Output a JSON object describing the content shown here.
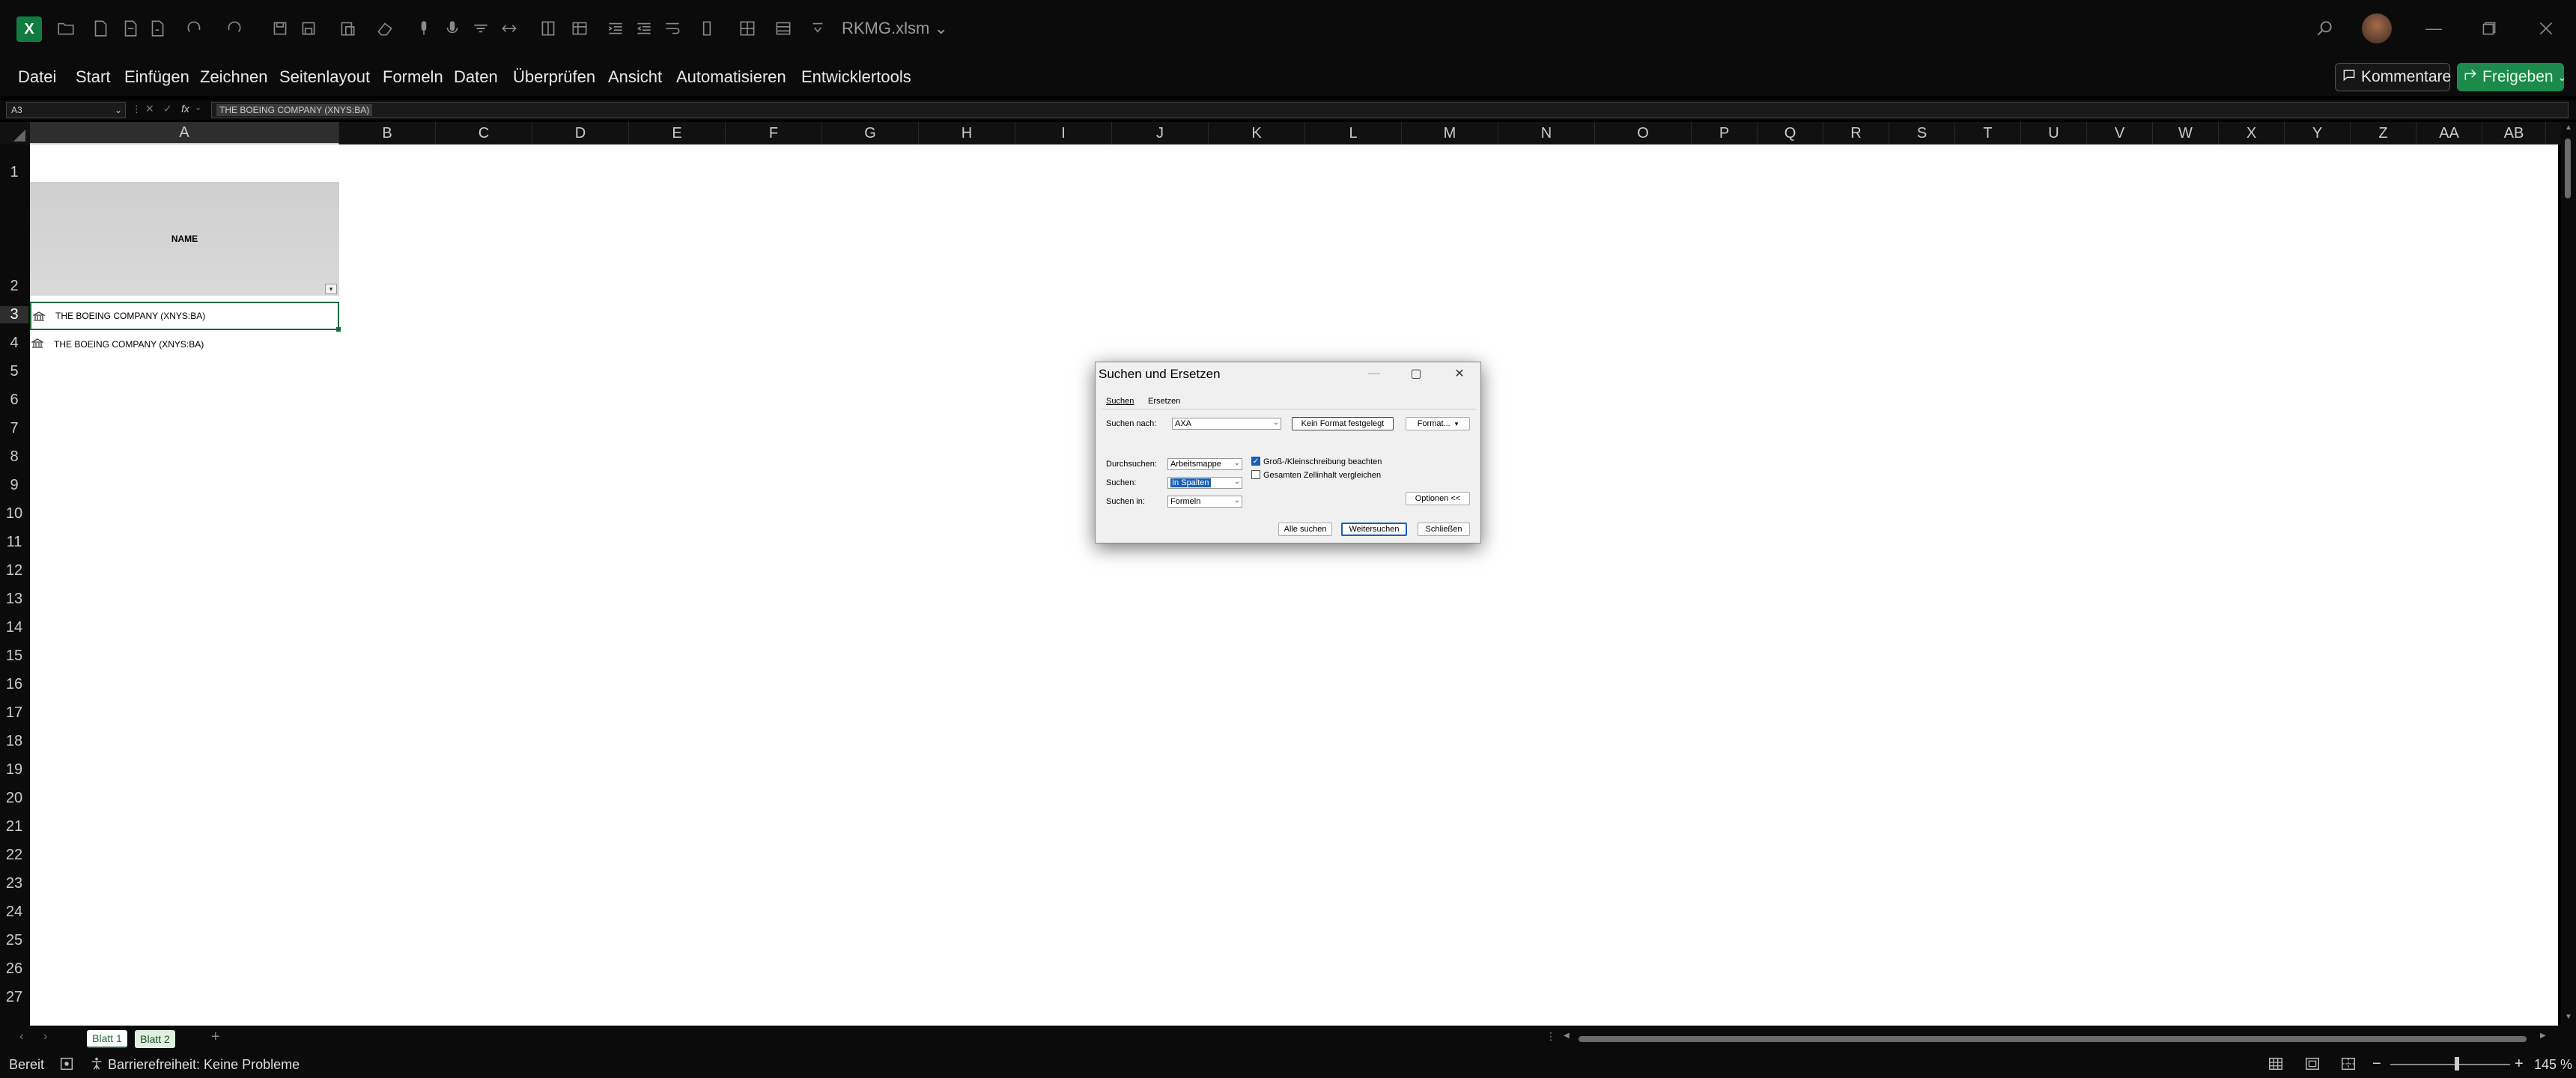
{
  "titlebar": {
    "app_icon": "excel-icon",
    "filename": "RKMG.xlsm"
  },
  "ribbon": {
    "tabs": [
      "Datei",
      "Start",
      "Einfügen",
      "Zeichnen",
      "Seitenlayout",
      "Formeln",
      "Daten",
      "Überprüfen",
      "Ansicht",
      "Automatisieren",
      "Entwicklertools"
    ],
    "comments_label": "Kommentare",
    "share_label": "Freigeben"
  },
  "formula_bar": {
    "name_box": "A3",
    "fx": "fx",
    "content": "THE BOEING COMPANY (XNYS:BA)"
  },
  "grid": {
    "columns": [
      "A",
      "B",
      "C",
      "D",
      "E",
      "F",
      "G",
      "H",
      "I",
      "J",
      "K",
      "L",
      "M",
      "N",
      "O",
      "P",
      "Q",
      "R",
      "S",
      "T",
      "U",
      "V",
      "W",
      "X",
      "Y",
      "Z",
      "AA",
      "AB"
    ],
    "rows": [
      "1",
      "2",
      "3",
      "4",
      "5",
      "6",
      "7",
      "8",
      "9",
      "10",
      "11",
      "12",
      "13",
      "14",
      "15",
      "16",
      "17",
      "18",
      "19",
      "20",
      "21",
      "22",
      "23",
      "24",
      "25",
      "26",
      "27"
    ],
    "header_label": "NAME",
    "cells": [
      {
        "ref": "A3",
        "text": "THE BOEING COMPANY (XNYS:BA)"
      },
      {
        "ref": "A4",
        "text": "THE BOEING COMPANY (XNYS:BA)"
      }
    ]
  },
  "sheet_tabs": {
    "tabs": [
      "Blatt 1",
      "Blatt 2"
    ],
    "add": "+"
  },
  "status": {
    "ready": "Bereit",
    "accessibility": "Barrierefreiheit: Keine Probleme",
    "zoom": "145 %"
  },
  "dialog": {
    "title": "Suchen und Ersetzen",
    "tabs": [
      "Suchen",
      "Ersetzen"
    ],
    "find_label": "Suchen nach:",
    "find_value": "AXA",
    "no_format_label": "Kein Format festgelegt",
    "format_label": "Format...",
    "within_label": "Durchsuchen:",
    "within_value": "Arbeitsmappe",
    "search_label": "Suchen:",
    "search_value": "In Spalten",
    "lookin_label": "Suchen in:",
    "lookin_value": "Formeln",
    "match_case_label": "Groß-/Kleinschreibung beachten",
    "match_case_checked": true,
    "entire_cell_label": "Gesamten Zellinhalt vergleichen",
    "entire_cell_checked": false,
    "options_label": "Optionen <<",
    "find_all_label": "Alle suchen",
    "find_next_label": "Weitersuchen",
    "close_label": "Schließen"
  }
}
